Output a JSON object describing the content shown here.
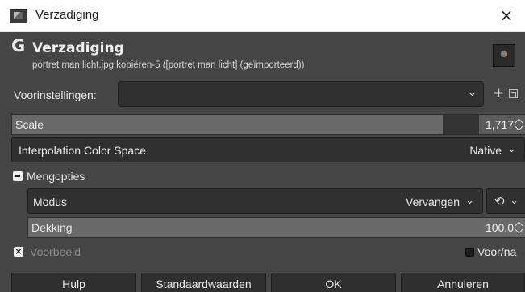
{
  "window": {
    "title": "Verzadiging",
    "close_glyph": "×"
  },
  "header": {
    "logo_glyph": "G",
    "title": "Verzadiging",
    "subtitle": "portret man licht.jpg kopiëren-5 ([portret man licht] (geïmporteerd))"
  },
  "presets": {
    "label": "Voorinstellingen:",
    "value": "",
    "add_glyph": "+"
  },
  "scale": {
    "label": "Scale",
    "value": "1,717",
    "fraction": 0.86
  },
  "interpolation": {
    "label": "Interpolation Color Space",
    "value": "Native"
  },
  "blending": {
    "label": "Mengopties",
    "mode_label": "Modus",
    "mode_value": "Vervangen",
    "composite_glyph": "⟲",
    "opacity_label": "Dekking",
    "opacity_value": "100,0"
  },
  "preview": {
    "check_glyph": "×",
    "label": "Voorbeeld",
    "split_label": "Voor/na"
  },
  "chevron_glyph": "⌄",
  "buttons": {
    "help": "Hulp",
    "reset": "Standaardwaarden",
    "ok": "OK",
    "cancel": "Annuleren"
  },
  "colors": {
    "dialog_bg": "#454545",
    "entry_bg": "#303030",
    "titlebar_bg": "#ffffff"
  }
}
